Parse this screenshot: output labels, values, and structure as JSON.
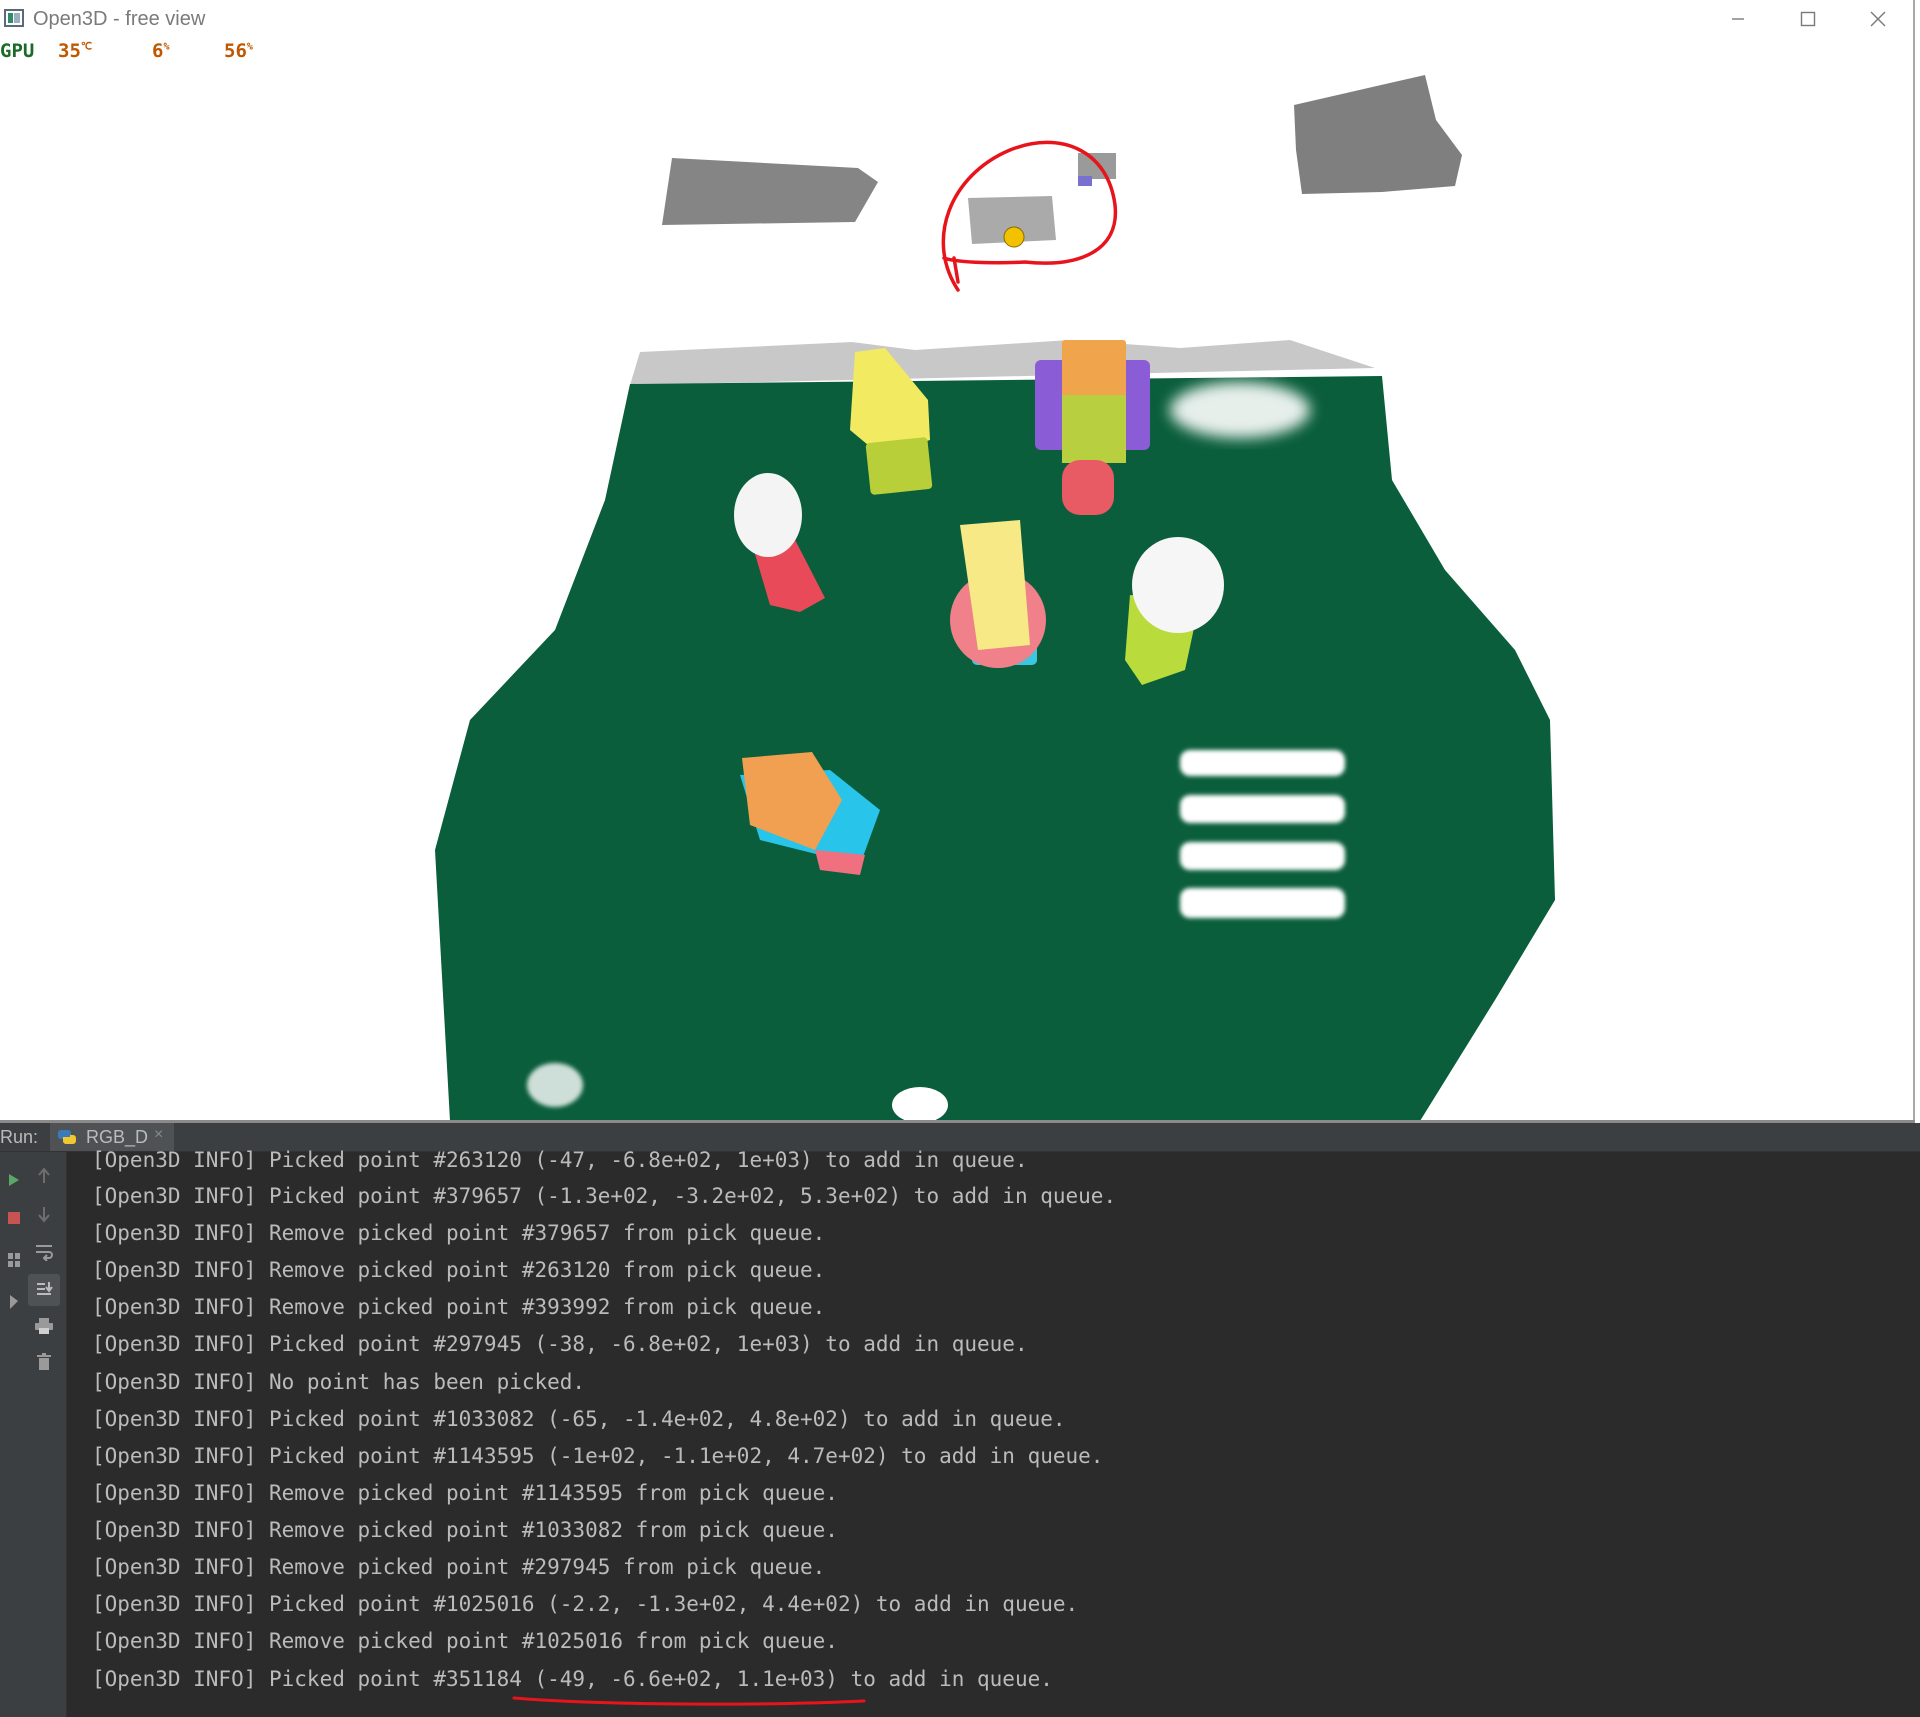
{
  "window": {
    "title": "Open3D - free view"
  },
  "osd": {
    "gpu_label": "GPU",
    "temperature": "35",
    "temperature_unit": "℃",
    "value_2": "6",
    "value_2_unit": "%",
    "value_3": "56",
    "value_3_unit": "%"
  },
  "ide": {
    "run_label": "Run:",
    "tab_label": "RGB_D"
  },
  "console": {
    "lines": [
      "[Open3D INFO] Picked point #263120 (-47, -6.8e+02, 1e+03) to add in queue.",
      "[Open3D INFO] Picked point #379657 (-1.3e+02, -3.2e+02, 5.3e+02) to add in queue.",
      "[Open3D INFO] Remove picked point #379657 from pick queue.",
      "[Open3D INFO] Remove picked point #263120 from pick queue.",
      "[Open3D INFO] Remove picked point #393992 from pick queue.",
      "[Open3D INFO] Picked point #297945 (-38, -6.8e+02, 1e+03) to add in queue.",
      "[Open3D INFO] No point has been picked.",
      "[Open3D INFO] Picked point #1033082 (-65, -1.4e+02, 4.8e+02) to add in queue.",
      "[Open3D INFO] Picked point #1143595 (-1e+02, -1.1e+02, 4.7e+02) to add in queue.",
      "[Open3D INFO] Remove picked point #1143595 from pick queue.",
      "[Open3D INFO] Remove picked point #1033082 from pick queue.",
      "[Open3D INFO] Remove picked point #297945 from pick queue.",
      "[Open3D INFO] Picked point #1025016 (-2.2, -1.3e+02, 4.4e+02) to add in queue.",
      "[Open3D INFO] Remove picked point #1025016 from pick queue.",
      "[Open3D INFO] Picked point #351184 (-49, -6.6e+02, 1.1e+03) to add in queue."
    ]
  },
  "colors": {
    "table_green": "#0a5e3c",
    "annotation_red": "#e8141c",
    "console_bg": "#2b2b2b",
    "console_text": "#bbbbbb",
    "picked_point": "#f2c200"
  }
}
